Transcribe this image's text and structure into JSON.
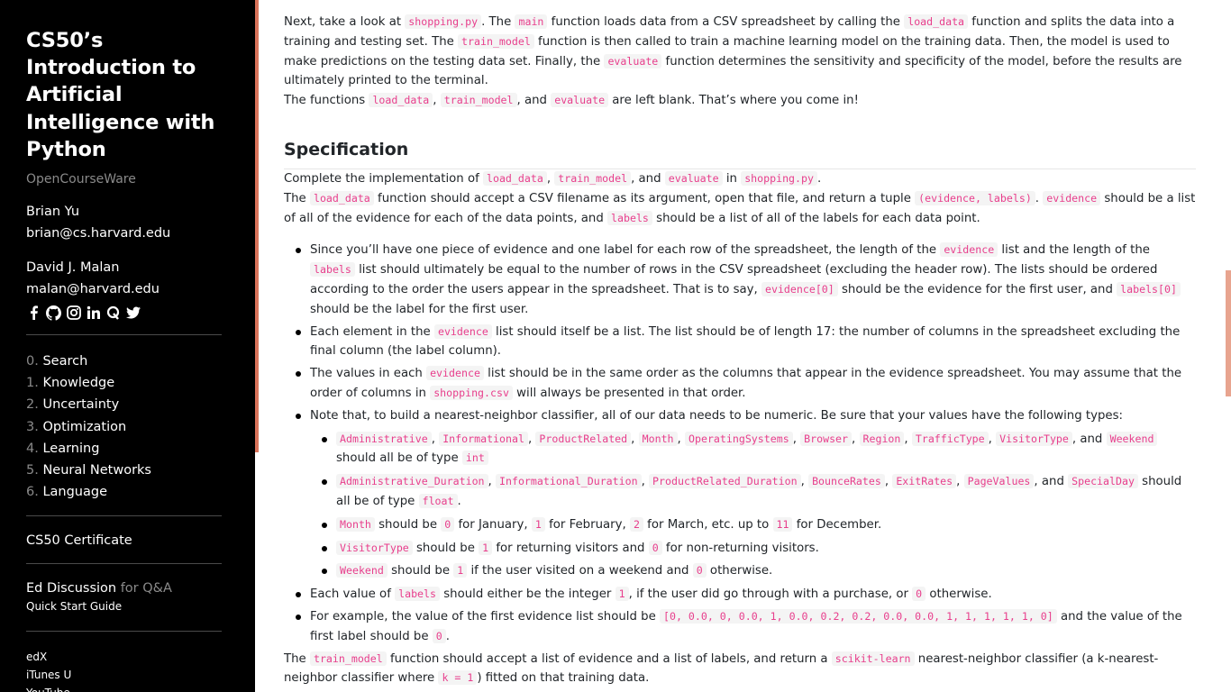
{
  "sidebar": {
    "title_lines": [
      "CS50’s",
      "Introduction to",
      "Artificial",
      "Intelligence with",
      "Python"
    ],
    "subtitle": "OpenCourseWare",
    "people": [
      {
        "name": "Brian Yu",
        "email": "brian@cs.harvard.edu"
      },
      {
        "name": "David J. Malan",
        "email": "malan@harvard.edu"
      }
    ],
    "social_icons": [
      "facebook-icon",
      "github-icon",
      "instagram-icon",
      "linkedin-icon",
      "quora-icon",
      "twitter-icon"
    ],
    "nav": [
      {
        "num": "0.",
        "label": "Search"
      },
      {
        "num": "1.",
        "label": "Knowledge"
      },
      {
        "num": "2.",
        "label": "Uncertainty"
      },
      {
        "num": "3.",
        "label": "Optimization"
      },
      {
        "num": "4.",
        "label": "Learning"
      },
      {
        "num": "5.",
        "label": "Neural Networks"
      },
      {
        "num": "6.",
        "label": "Language"
      }
    ],
    "certificate": "CS50 Certificate",
    "ed_discussion": "Ed Discussion",
    "ed_suffix": "for Q&A",
    "quick_start": "Quick Start Guide",
    "external": [
      "edX",
      "iTunes U",
      "YouTube"
    ]
  },
  "content": {
    "p1": [
      {
        "t": "Next, take a look at "
      },
      {
        "c": "shopping.py"
      },
      {
        "t": ". The "
      },
      {
        "c": "main"
      },
      {
        "t": " function loads data from a CSV spreadsheet by calling the "
      },
      {
        "c": "load_data"
      },
      {
        "t": " function and splits the data into a training and testing set. The "
      },
      {
        "c": "train_model"
      },
      {
        "t": " function is then called to train a machine learning model on the training data. Then, the model is used to make predictions on the testing data set. Finally, the "
      },
      {
        "c": "evaluate"
      },
      {
        "t": " function determines the sensitivity and specificity of the model, before the results are ultimately printed to the terminal."
      }
    ],
    "p2": [
      {
        "t": "The functions "
      },
      {
        "c": "load_data"
      },
      {
        "t": ", "
      },
      {
        "c": "train_model"
      },
      {
        "t": ", and "
      },
      {
        "c": "evaluate"
      },
      {
        "t": " are left blank. That’s where you come in!"
      }
    ],
    "heading": "Specification",
    "p3": [
      {
        "t": "Complete the implementation of "
      },
      {
        "c": "load_data"
      },
      {
        "t": ", "
      },
      {
        "c": "train_model"
      },
      {
        "t": ", and "
      },
      {
        "c": "evaluate"
      },
      {
        "t": " in "
      },
      {
        "c": "shopping.py"
      },
      {
        "t": "."
      }
    ],
    "p4": [
      {
        "t": "The "
      },
      {
        "c": "load_data"
      },
      {
        "t": " function should accept a CSV filename as its argument, open that file, and return a tuple "
      },
      {
        "c": "(evidence, labels)"
      },
      {
        "t": ". "
      },
      {
        "c": "evidence"
      },
      {
        "t": " should be a list of all of the evidence for each of the data points, and "
      },
      {
        "c": "labels"
      },
      {
        "t": " should be a list of all of the labels for each data point."
      }
    ],
    "bullets": [
      [
        {
          "t": "Since you’ll have one piece of evidence and one label for each row of the spreadsheet, the length of the "
        },
        {
          "c": "evidence"
        },
        {
          "t": " list and the length of the "
        },
        {
          "c": "labels"
        },
        {
          "t": " list should ultimately be equal to the number of rows in the CSV spreadsheet (excluding the header row). The lists should be ordered according to the order the users appear in the spreadsheet. That is to say, "
        },
        {
          "c": "evidence[0]"
        },
        {
          "t": " should be the evidence for the first user, and "
        },
        {
          "c": "labels[0]"
        },
        {
          "t": " should be the label for the first user."
        }
      ],
      [
        {
          "t": "Each element in the "
        },
        {
          "c": "evidence"
        },
        {
          "t": " list should itself be a list. The list should be of length 17: the number of columns in the spreadsheet excluding the final column (the label column)."
        }
      ],
      [
        {
          "t": "The values in each "
        },
        {
          "c": "evidence"
        },
        {
          "t": " list should be in the same order as the columns that appear in the evidence spreadsheet. You may assume that the order of columns in "
        },
        {
          "c": "shopping.csv"
        },
        {
          "t": " will always be presented in that order."
        }
      ],
      [
        {
          "t": "Note that, to build a nearest-neighbor classifier, all of our data needs to be numeric. Be sure that your values have the following types:"
        }
      ]
    ],
    "sub_bullets": [
      [
        {
          "c": "Administrative"
        },
        {
          "t": ", "
        },
        {
          "c": "Informational"
        },
        {
          "t": ", "
        },
        {
          "c": "ProductRelated"
        },
        {
          "t": ", "
        },
        {
          "c": "Month"
        },
        {
          "t": ", "
        },
        {
          "c": "OperatingSystems"
        },
        {
          "t": ", "
        },
        {
          "c": "Browser"
        },
        {
          "t": ", "
        },
        {
          "c": "Region"
        },
        {
          "t": ", "
        },
        {
          "c": "TrafficType"
        },
        {
          "t": ", "
        },
        {
          "c": "VisitorType"
        },
        {
          "t": ", and "
        },
        {
          "c": "Weekend"
        },
        {
          "t": " should all be of type "
        },
        {
          "c": "int"
        }
      ],
      [
        {
          "c": "Administrative_Duration"
        },
        {
          "t": ", "
        },
        {
          "c": "Informational_Duration"
        },
        {
          "t": ", "
        },
        {
          "c": "ProductRelated_Duration"
        },
        {
          "t": ", "
        },
        {
          "c": "BounceRates"
        },
        {
          "t": ", "
        },
        {
          "c": "ExitRates"
        },
        {
          "t": ", "
        },
        {
          "c": "PageValues"
        },
        {
          "t": ", and "
        },
        {
          "c": "SpecialDay"
        },
        {
          "t": " should all be of type "
        },
        {
          "c": "float"
        },
        {
          "t": "."
        }
      ],
      [
        {
          "c": "Month"
        },
        {
          "t": " should be "
        },
        {
          "c": "0"
        },
        {
          "t": " for January, "
        },
        {
          "c": "1"
        },
        {
          "t": " for February, "
        },
        {
          "c": "2"
        },
        {
          "t": " for March, etc. up to "
        },
        {
          "c": "11"
        },
        {
          "t": " for December."
        }
      ],
      [
        {
          "c": "VisitorType"
        },
        {
          "t": " should be "
        },
        {
          "c": "1"
        },
        {
          "t": " for returning visitors and "
        },
        {
          "c": "0"
        },
        {
          "t": " for non-returning visitors."
        }
      ],
      [
        {
          "c": "Weekend"
        },
        {
          "t": " should be "
        },
        {
          "c": "1"
        },
        {
          "t": " if the user visited on a weekend and "
        },
        {
          "c": "0"
        },
        {
          "t": " otherwise."
        }
      ]
    ],
    "bullets2": [
      [
        {
          "t": "Each value of "
        },
        {
          "c": "labels"
        },
        {
          "t": " should either be the integer "
        },
        {
          "c": "1"
        },
        {
          "t": ", if the user did go through with a purchase, or "
        },
        {
          "c": "0"
        },
        {
          "t": " otherwise."
        }
      ],
      [
        {
          "t": "For example, the value of the first evidence list should be "
        },
        {
          "c": "[0, 0.0, 0, 0.0, 1, 0.0, 0.2, 0.2, 0.0, 0.0, 1, 1, 1, 1, 1, 0]"
        },
        {
          "t": " and the value of the first label should be "
        },
        {
          "c": "0"
        },
        {
          "t": "."
        }
      ]
    ],
    "p5": [
      {
        "t": "The "
      },
      {
        "c": "train_model"
      },
      {
        "t": " function should accept a list of evidence and a list of labels, and return a "
      },
      {
        "c": "scikit-learn"
      },
      {
        "t": " nearest-neighbor classifier (a k-nearest-neighbor classifier where "
      },
      {
        "c": "k = 1"
      },
      {
        "t": ") fitted on that training data."
      }
    ]
  },
  "colors": {
    "code": "#e83e8c",
    "accent": "#d9735a",
    "sidebar_bg": "#000000"
  }
}
